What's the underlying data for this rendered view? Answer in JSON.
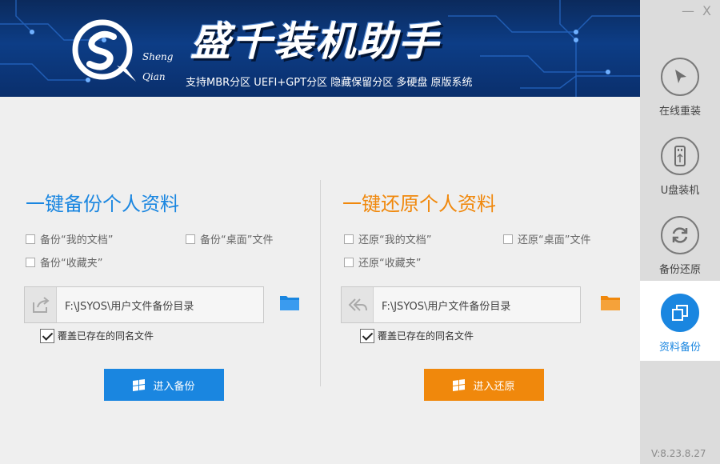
{
  "banner": {
    "title": "盛千装机助手",
    "logo_line1": "Sheng",
    "logo_line2": "Qian",
    "subtitle": "支持MBR分区 UEFI+GPT分区 隐藏保留分区 多硬盘   原版系统"
  },
  "window": {
    "minimize": "—",
    "close": "X"
  },
  "sidebar": {
    "items": [
      {
        "label": "在线重装",
        "icon": "cursor-icon",
        "active": false
      },
      {
        "label": "U盘装机",
        "icon": "usb-icon",
        "active": false
      },
      {
        "label": "备份还原",
        "icon": "refresh-icon",
        "active": false
      },
      {
        "label": "资料备份",
        "icon": "copy-icon",
        "active": true
      }
    ],
    "version": "V:8.23.8.27"
  },
  "backup": {
    "title": "一键备份个人资料",
    "options": [
      "备份“我的文档”",
      "备份“桌面”文件",
      "备份“收藏夹”"
    ],
    "path": "F:\\JSYOS\\用户文件备份目录",
    "overwrite_label": "覆盖已存在的同名文件",
    "overwrite_checked": true,
    "button_label": "进入备份",
    "accent": "#1a86e0"
  },
  "restore": {
    "title": "一键还原个人资料",
    "options": [
      "还原“我的文档”",
      "还原“桌面”文件",
      "还原“收藏夹”"
    ],
    "path": "F:\\JSYOS\\用户文件备份目录",
    "overwrite_label": "覆盖已存在的同名文件",
    "overwrite_checked": true,
    "button_label": "进入还原",
    "accent": "#f0880c"
  }
}
